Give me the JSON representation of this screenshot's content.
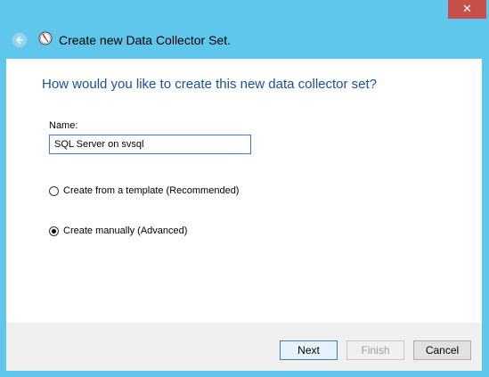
{
  "window": {
    "title": "Create new Data Collector Set.",
    "close_label": "✕",
    "accent_color": "#5fc7ec",
    "close_color": "#c7504a"
  },
  "main": {
    "heading": "How would you like to create this new data collector set?",
    "name_label": "Name:",
    "name_value": "SQL Server on svsql",
    "options": [
      {
        "label": "Create from a template (Recommended)",
        "selected": false
      },
      {
        "label": "Create manually (Advanced)",
        "selected": true
      }
    ]
  },
  "footer": {
    "next_label": "Next",
    "finish_label": "Finish",
    "cancel_label": "Cancel"
  },
  "icons": {
    "back": "back-arrow-icon",
    "app": "data-collector-gauge-icon"
  }
}
